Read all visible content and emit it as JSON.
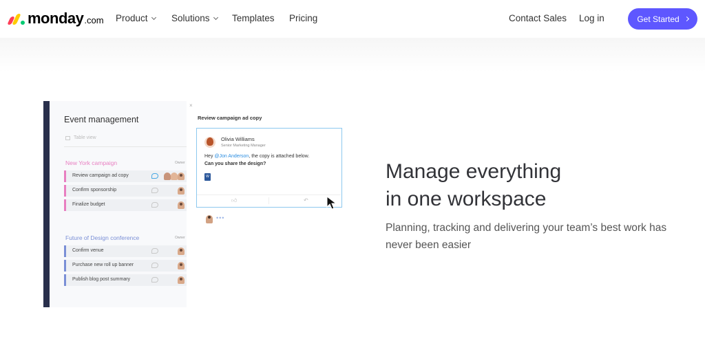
{
  "nav": {
    "logo_word": "monday",
    "logo_suffix": ".com",
    "items": [
      {
        "label": "Product",
        "has_dropdown": true
      },
      {
        "label": "Solutions",
        "has_dropdown": true
      },
      {
        "label": "Templates",
        "has_dropdown": false
      },
      {
        "label": "Pricing",
        "has_dropdown": false
      }
    ],
    "contact_sales": "Contact Sales",
    "login": "Log in",
    "cta": "Get Started"
  },
  "mockup": {
    "board_title": "Event management",
    "view_label": "Table view",
    "groups": [
      {
        "title": "New York campaign",
        "color": "#e87fc1",
        "owner_label": "Owner",
        "rows": [
          "Review campaign ad copy",
          "Confirm sponsorship",
          "Finalize budget"
        ]
      },
      {
        "title": "Future of Design conference",
        "color": "#7a8fd6",
        "owner_label": "Owner",
        "rows": [
          "Confirm venue",
          "Purchase new roll up banner",
          "Publish blog post summary"
        ]
      }
    ],
    "panel": {
      "title": "Review campaign ad copy",
      "author": "Olivia Williams",
      "role": "Senior Marketing Manager",
      "msg_prefix": "Hey ",
      "mention": "@Jon Anderson",
      "msg_suffix": ", the copy is attached below.",
      "msg_line2": "Can you share the design?",
      "typing_dots": "•••"
    }
  },
  "hero": {
    "headline_line1": "Manage everything",
    "headline_line2": "in one workspace",
    "subtext": "Planning, tracking and delivering your team’s best work has never been easier"
  },
  "colors": {
    "brand_button": "#5e57ff",
    "sidebar": "#292f4c",
    "mention": "#2b8de0"
  }
}
